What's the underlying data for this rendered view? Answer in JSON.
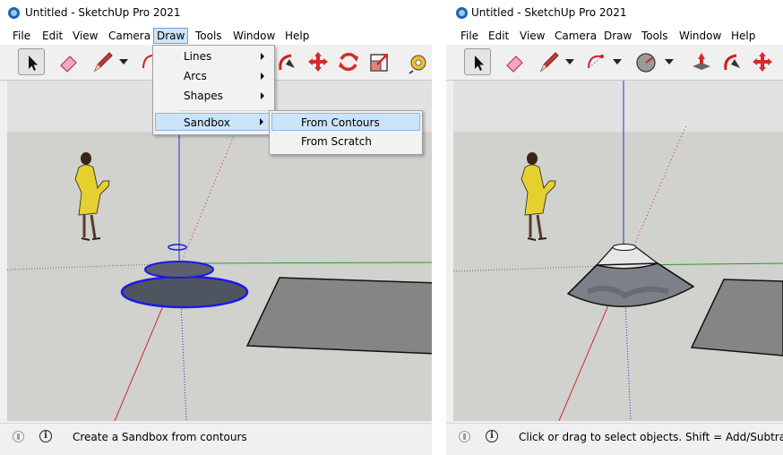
{
  "app": {
    "title": "Untitled - SketchUp Pro 2021"
  },
  "menubar": {
    "items": [
      "File",
      "Edit",
      "View",
      "Camera",
      "Draw",
      "Tools",
      "Window",
      "Help"
    ],
    "active": "Draw"
  },
  "draw_menu": {
    "items": [
      "Lines",
      "Arcs",
      "Shapes",
      "Sandbox"
    ],
    "highlighted": "Sandbox"
  },
  "sandbox_submenu": {
    "items": [
      "From Contours",
      "From Scratch"
    ],
    "highlighted": "From Contours"
  },
  "left_window": {
    "status_text": "Create a Sandbox from contours"
  },
  "right_window": {
    "status_text": "Click or drag to select objects. Shift = Add/Subtra"
  },
  "icons": {
    "select": "select-arrow-icon",
    "eraser": "eraser-icon",
    "pencil": "pencil-line-icon",
    "arc": "arc-icon",
    "shapes": "shapes-icon",
    "pushpull": "push-pull-icon",
    "followme": "follow-me-icon",
    "move": "move-icon",
    "rotate": "rotate-icon",
    "scale": "scale-icon",
    "tape": "tape-measure-icon"
  },
  "colors": {
    "axis_red": "#cc2b2b",
    "axis_green": "#2a9a2a",
    "axis_blue": "#2b2bd6",
    "sky": "#e2e2e2",
    "ground": "#d1d1cd",
    "selection": "#1a1ae6"
  }
}
